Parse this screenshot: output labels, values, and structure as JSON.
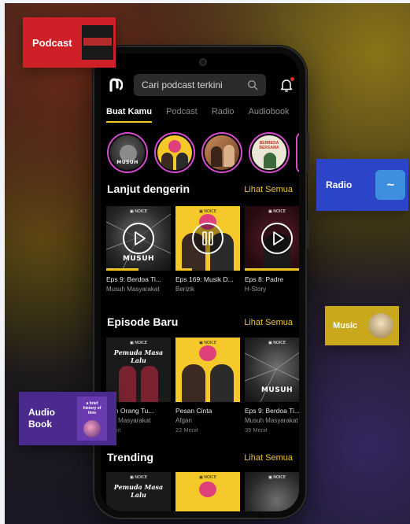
{
  "app": {
    "search": {
      "placeholder": "Cari podcast terkini"
    },
    "tabs": [
      {
        "label": "Buat Kamu",
        "active": true
      },
      {
        "label": "Podcast",
        "active": false
      },
      {
        "label": "Radio",
        "active": false
      },
      {
        "label": "Audiobook",
        "active": false
      }
    ],
    "stories": [
      {
        "caption": "MUSUH"
      },
      {
        "caption": ""
      },
      {
        "caption": ""
      },
      {
        "caption": "BERBEDA BERSAMA"
      }
    ],
    "continue_listening": {
      "title": "Lanjut dengerin",
      "see_all": "Lihat Semua",
      "items": [
        {
          "title": "Eps 9: Berdoa Ti...",
          "show": "Musuh Masyarakat",
          "progress": 0.5,
          "thumb_label": "MUSUH"
        },
        {
          "title": "Eps 169: Musik D...",
          "show": "Berizik",
          "progress": 0.25,
          "thumb_label": ""
        },
        {
          "title": "Eps 8: Padre",
          "show": "H-Story",
          "progress": 0.85,
          "thumb_label": ""
        }
      ]
    },
    "new_episodes": {
      "title": "Episode Baru",
      "see_all": "Lihat Semua",
      "items": [
        {
          "title": "ikan Orang Tu...",
          "show": "suh Masyarakat",
          "meta": "Menit",
          "thumb_label": "Pemuda Masa Lalu"
        },
        {
          "title": "Pesan Cinta",
          "show": "Afgan",
          "meta": "22 Menit",
          "thumb_label": ""
        },
        {
          "title": "Eps 9: Berdoa Ti...",
          "show": "Musuh Masyarakat",
          "meta": "39 Menit",
          "thumb_label": "MUSUH"
        }
      ]
    },
    "trending": {
      "title": "Trending",
      "see_all": "Lihat Semua",
      "items": [
        {
          "thumb_label": "Pemuda Masa Lalu"
        },
        {
          "thumb_label": ""
        },
        {
          "thumb_label": ""
        }
      ]
    }
  },
  "floating_badges": {
    "podcast": "Podcast",
    "radio": "Radio",
    "music": "Music",
    "audiobook": "Audio Book",
    "book_cover_text": "a brief history of time"
  },
  "colors": {
    "accent": "#f3c623",
    "podcast_badge": "#cf1f27",
    "radio_badge": "#2c45c8",
    "music_badge": "#c9a81c",
    "audiobook_badge": "#4a2a8c",
    "story_ring": "#d64bd0"
  }
}
